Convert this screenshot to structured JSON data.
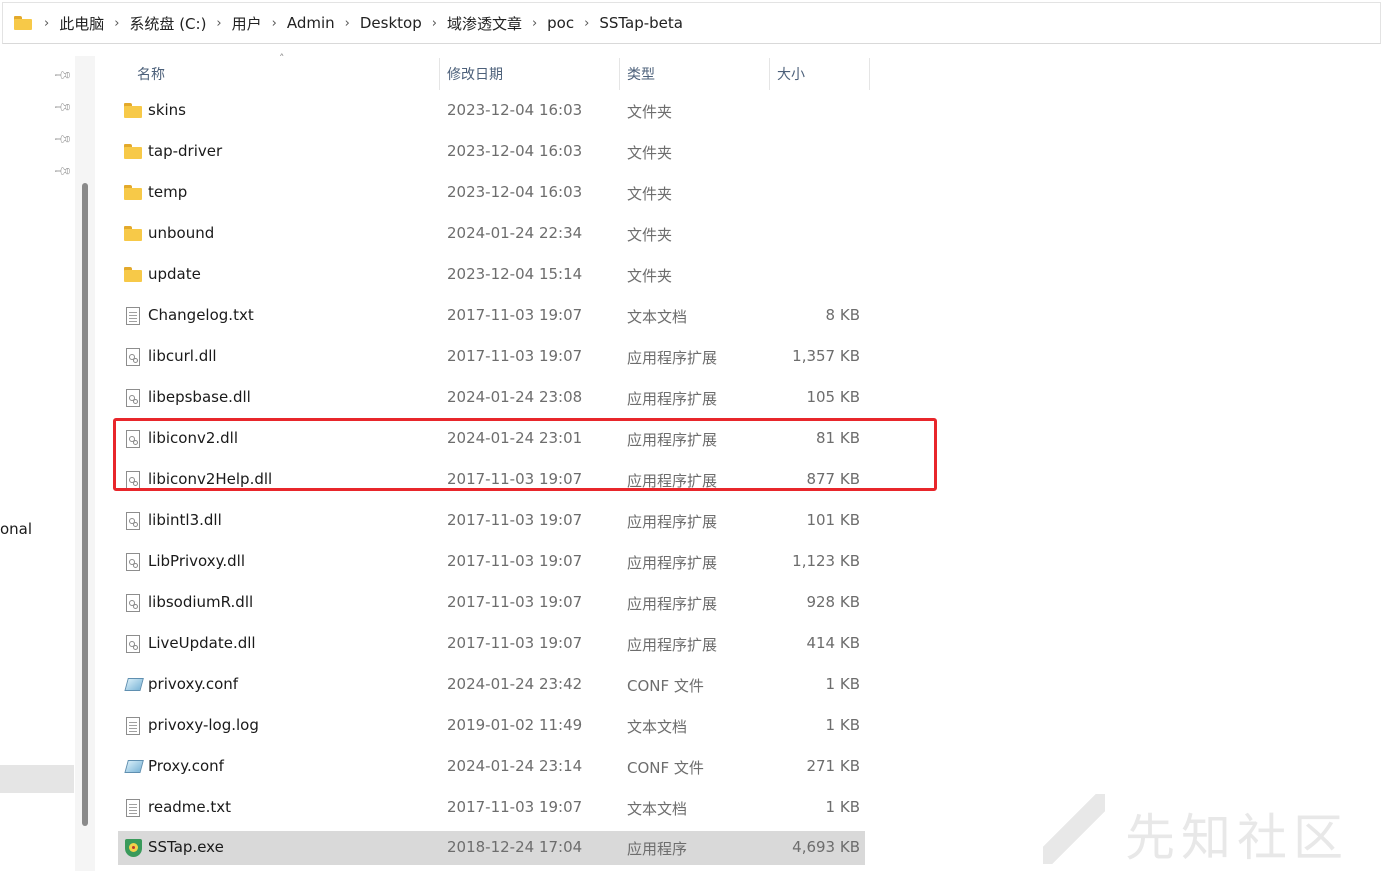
{
  "breadcrumb": [
    "此电脑",
    "系统盘 (C:)",
    "用户",
    "Admin",
    "Desktop",
    "域渗透文章",
    "poc",
    "SSTap-beta"
  ],
  "nav": {
    "partial_label": "onal"
  },
  "columns": {
    "name": "名称",
    "date": "修改日期",
    "type": "类型",
    "size": "大小"
  },
  "files": [
    {
      "name": "skins",
      "date": "2023-12-04 16:03",
      "type": "文件夹",
      "size": "",
      "icon": "folder-icon"
    },
    {
      "name": "tap-driver",
      "date": "2023-12-04 16:03",
      "type": "文件夹",
      "size": "",
      "icon": "folder-icon"
    },
    {
      "name": "temp",
      "date": "2023-12-04 16:03",
      "type": "文件夹",
      "size": "",
      "icon": "folder-icon"
    },
    {
      "name": "unbound",
      "date": "2024-01-24 22:34",
      "type": "文件夹",
      "size": "",
      "icon": "folder-icon"
    },
    {
      "name": "update",
      "date": "2023-12-04 15:14",
      "type": "文件夹",
      "size": "",
      "icon": "folder-icon"
    },
    {
      "name": "Changelog.txt",
      "date": "2017-11-03 19:07",
      "type": "文本文档",
      "size": "8 KB",
      "icon": "text-file-icon"
    },
    {
      "name": "libcurl.dll",
      "date": "2017-11-03 19:07",
      "type": "应用程序扩展",
      "size": "1,357 KB",
      "icon": "dll-file-icon"
    },
    {
      "name": "libepsbase.dll",
      "date": "2024-01-24 23:08",
      "type": "应用程序扩展",
      "size": "105 KB",
      "icon": "dll-file-icon"
    },
    {
      "name": "libiconv2.dll",
      "date": "2024-01-24 23:01",
      "type": "应用程序扩展",
      "size": "81 KB",
      "icon": "dll-file-icon"
    },
    {
      "name": "libiconv2Help.dll",
      "date": "2017-11-03 19:07",
      "type": "应用程序扩展",
      "size": "877 KB",
      "icon": "dll-file-icon"
    },
    {
      "name": "libintl3.dll",
      "date": "2017-11-03 19:07",
      "type": "应用程序扩展",
      "size": "101 KB",
      "icon": "dll-file-icon"
    },
    {
      "name": "LibPrivoxy.dll",
      "date": "2017-11-03 19:07",
      "type": "应用程序扩展",
      "size": "1,123 KB",
      "icon": "dll-file-icon"
    },
    {
      "name": "libsodiumR.dll",
      "date": "2017-11-03 19:07",
      "type": "应用程序扩展",
      "size": "928 KB",
      "icon": "dll-file-icon"
    },
    {
      "name": "LiveUpdate.dll",
      "date": "2017-11-03 19:07",
      "type": "应用程序扩展",
      "size": "414 KB",
      "icon": "dll-file-icon"
    },
    {
      "name": "privoxy.conf",
      "date": "2024-01-24 23:42",
      "type": "CONF 文件",
      "size": "1 KB",
      "icon": "conf-file-icon"
    },
    {
      "name": "privoxy-log.log",
      "date": "2019-01-02 11:49",
      "type": "文本文档",
      "size": "1 KB",
      "icon": "text-file-icon"
    },
    {
      "name": "Proxy.conf",
      "date": "2024-01-24 23:14",
      "type": "CONF 文件",
      "size": "271 KB",
      "icon": "conf-file-icon"
    },
    {
      "name": "readme.txt",
      "date": "2017-11-03 19:07",
      "type": "文本文档",
      "size": "1 KB",
      "icon": "text-file-icon"
    },
    {
      "name": "SSTap.exe",
      "date": "2018-12-24 17:04",
      "type": "应用程序",
      "size": "4,693 KB",
      "icon": "sstap-app-icon",
      "selected": true
    }
  ],
  "highlight_color": "#e8262b",
  "watermark_text": "先知社区"
}
